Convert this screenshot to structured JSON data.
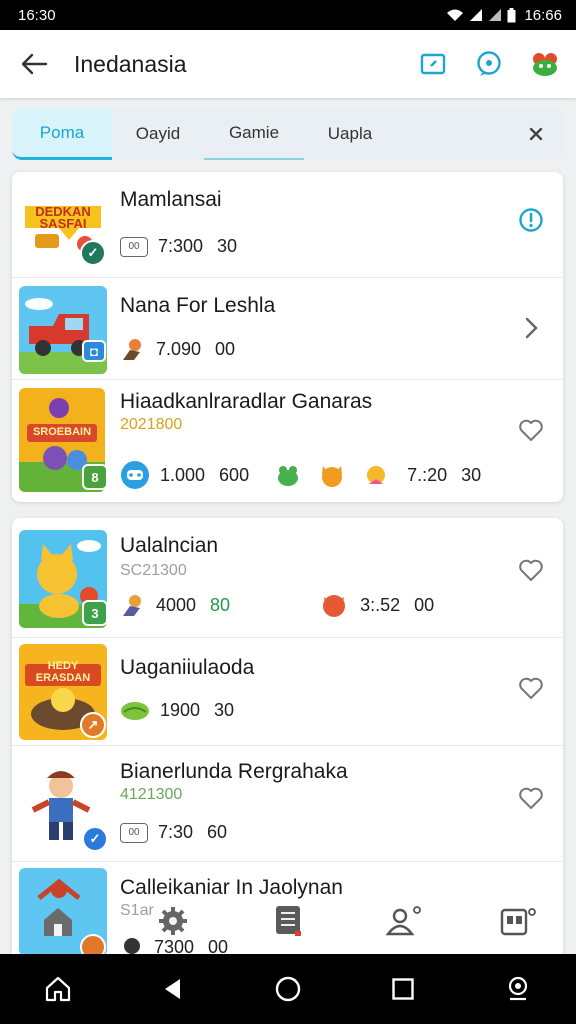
{
  "status_bar": {
    "left_time": "16:30",
    "right_time": "16:66"
  },
  "header": {
    "title": "Inedanasia"
  },
  "tabs": [
    {
      "label": "Poma"
    },
    {
      "label": "Oayid"
    },
    {
      "label": "Gamie"
    },
    {
      "label": "Uapla"
    }
  ],
  "items": [
    {
      "title": "Mamlansai",
      "thumb_text": "DEDKAN SASFAI",
      "badge": "✓",
      "meta": [
        "7:300",
        "30"
      ]
    },
    {
      "title": "Nana For Leshla",
      "meta": [
        "7.090",
        "00"
      ]
    },
    {
      "title": "Hiaadkanlraradlar Ganaras",
      "subtitle": "2021800",
      "thumb_text": "SROEBAIN",
      "badge": "8",
      "meta": [
        "1.000",
        "600",
        "7.:20",
        "30"
      ]
    },
    {
      "title": "Ualalncian",
      "subtitle": "SC21300",
      "badge": "3",
      "meta": [
        "4000",
        "80",
        "3:.52",
        "00"
      ]
    },
    {
      "title": "Uaganiiulaoda",
      "thumb_text": "HEDY ERASDAN",
      "meta": [
        "1900",
        "30"
      ]
    },
    {
      "title": "Bianerlunda Rergrahaka",
      "subtitle": "4121300",
      "meta": [
        "7:30",
        "60"
      ]
    },
    {
      "title": "Calleikaniar In Jaolynan",
      "subtitle": "S1ar",
      "meta": [
        "7300",
        "00"
      ]
    }
  ],
  "colors": {
    "accent": "#1aa6cf",
    "green_value": "#1f9a4a",
    "subtitle_gold": "#d9a21b"
  }
}
